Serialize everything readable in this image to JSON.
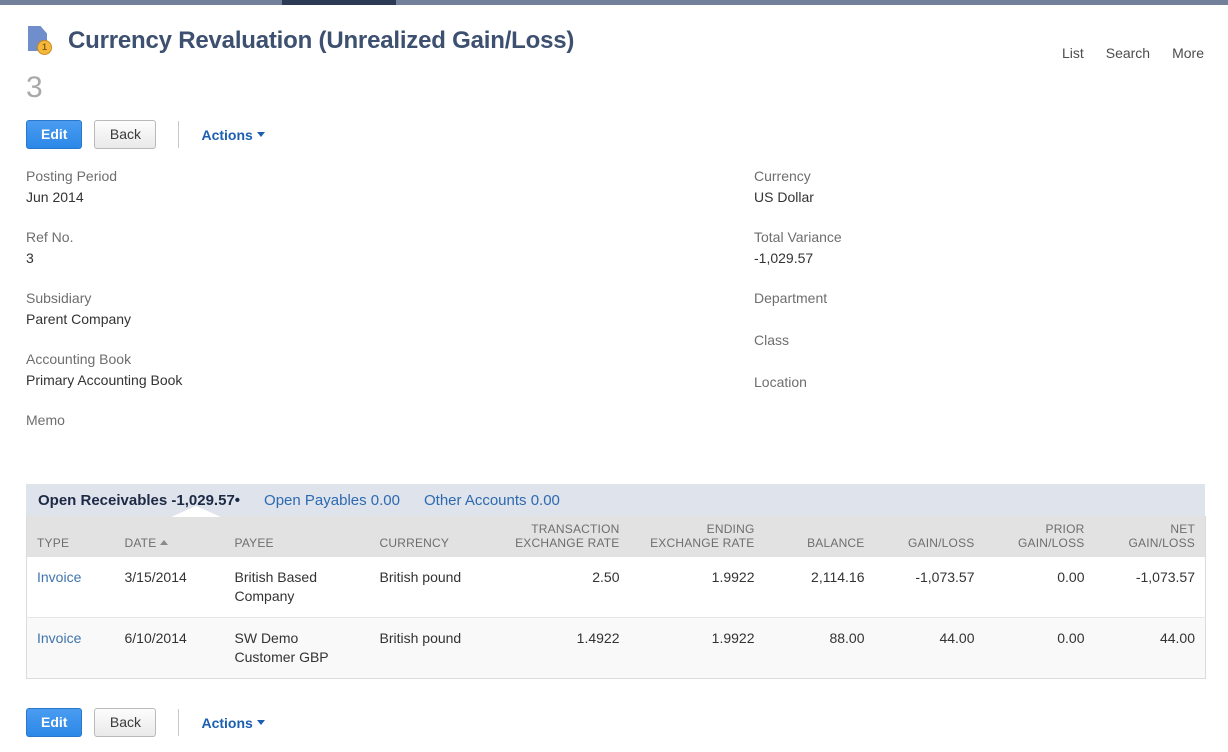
{
  "chrome": {
    "strip_color": "#73809c",
    "active_tab_color": "#2c3a55"
  },
  "header": {
    "icon": "document-coin-icon",
    "coin_badge": "1",
    "title": "Currency Revaluation (Unrealized Gain/Loss)",
    "record_id": "3",
    "links": [
      {
        "label": "List"
      },
      {
        "label": "Search"
      },
      {
        "label": "More"
      }
    ]
  },
  "toolbar": {
    "edit_label": "Edit",
    "back_label": "Back",
    "actions_label": "Actions"
  },
  "fields": {
    "left": [
      {
        "label": "Posting Period",
        "value": "Jun 2014"
      },
      {
        "label": "Ref No.",
        "value": "3"
      },
      {
        "label": "Subsidiary",
        "value": "Parent Company"
      },
      {
        "label": "Accounting Book",
        "value": "Primary Accounting Book"
      },
      {
        "label": "Memo",
        "value": ""
      }
    ],
    "right": [
      {
        "label": "Currency",
        "value": "US Dollar"
      },
      {
        "label": "Total Variance",
        "value": "-1,029.57"
      },
      {
        "label": "Department",
        "value": ""
      },
      {
        "label": "Class",
        "value": ""
      },
      {
        "label": "Location",
        "value": ""
      }
    ]
  },
  "sublist": {
    "tabs": [
      {
        "label": "Open Receivables -1,029.57",
        "marker": "•",
        "active": true
      },
      {
        "label": "Open Payables 0.00",
        "marker": "",
        "active": false
      },
      {
        "label": "Other Accounts 0.00",
        "marker": "",
        "active": false
      }
    ],
    "columns": [
      {
        "key": "type",
        "line1": "",
        "line2": "TYPE",
        "align": "l"
      },
      {
        "key": "date",
        "line1": "",
        "line2": "DATE",
        "align": "l",
        "sorted": "asc"
      },
      {
        "key": "payee",
        "line1": "",
        "line2": "PAYEE",
        "align": "l"
      },
      {
        "key": "currency",
        "line1": "",
        "line2": "CURRENCY",
        "align": "l"
      },
      {
        "key": "txrate",
        "line1": "TRANSACTION",
        "line2": "EXCHANGE RATE",
        "align": "r"
      },
      {
        "key": "endrate",
        "line1": "ENDING",
        "line2": "EXCHANGE RATE",
        "align": "r"
      },
      {
        "key": "balance",
        "line1": "",
        "line2": "BALANCE",
        "align": "r"
      },
      {
        "key": "gainloss",
        "line1": "",
        "line2": "GAIN/LOSS",
        "align": "r"
      },
      {
        "key": "prior",
        "line1": "PRIOR",
        "line2": "GAIN/LOSS",
        "align": "r"
      },
      {
        "key": "net",
        "line1": "NET",
        "line2": "GAIN/LOSS",
        "align": "r"
      }
    ],
    "rows": [
      {
        "type": "Invoice",
        "date": "3/15/2014",
        "payee": "British Based Company",
        "currency": "British pound",
        "txrate": "2.50",
        "endrate": "1.9922",
        "balance": "2,114.16",
        "gainloss": "-1,073.57",
        "prior": "0.00",
        "net": "-1,073.57"
      },
      {
        "type": "Invoice",
        "date": "6/10/2014",
        "payee": "SW Demo Customer GBP",
        "currency": "British pound",
        "txrate": "1.4922",
        "endrate": "1.9922",
        "balance": "88.00",
        "gainloss": "44.00",
        "prior": "0.00",
        "net": "44.00"
      }
    ]
  }
}
